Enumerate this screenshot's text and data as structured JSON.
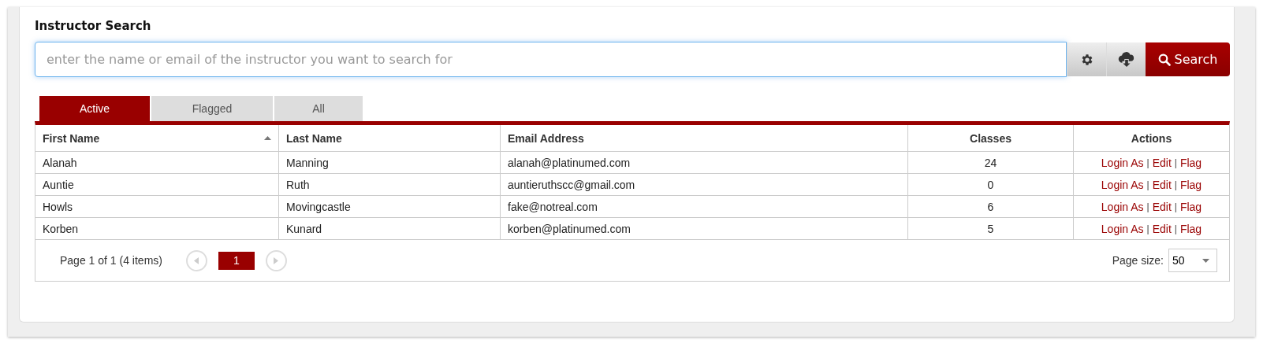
{
  "title": "Instructor Search",
  "search": {
    "placeholder": "enter the name or email of the instructor you want to search for",
    "button": "Search"
  },
  "tabs": [
    {
      "label": "Active",
      "selected": true
    },
    {
      "label": "Flagged",
      "selected": false
    },
    {
      "label": "All",
      "selected": false
    }
  ],
  "table": {
    "columns": [
      {
        "label": "First Name",
        "centered": false,
        "sorted_ascending": true
      },
      {
        "label": "Last Name",
        "centered": false,
        "sorted_ascending": false
      },
      {
        "label": "Email Address",
        "centered": false,
        "sorted_ascending": false
      },
      {
        "label": "Classes",
        "centered": true,
        "sorted_ascending": false
      },
      {
        "label": "Actions",
        "centered": true,
        "sorted_ascending": false
      }
    ],
    "action_separator": "|",
    "rows": [
      {
        "cells": [
          "Alanah",
          "Manning",
          "alanah@platinumed.com",
          "24"
        ],
        "actions": [
          "Login As",
          "Edit",
          "Flag"
        ]
      },
      {
        "cells": [
          "Auntie",
          "Ruth",
          "auntieruthscc@gmail.com",
          "0"
        ],
        "actions": [
          "Login As",
          "Edit",
          "Flag"
        ]
      },
      {
        "cells": [
          "Howls",
          "Movingcastle",
          "fake@notreal.com",
          "6"
        ],
        "actions": [
          "Login As",
          "Edit",
          "Flag"
        ]
      },
      {
        "cells": [
          "Korben",
          "Kunard",
          "korben@platinumed.com",
          "5"
        ],
        "actions": [
          "Login As",
          "Edit",
          "Flag"
        ]
      }
    ]
  },
  "pager": {
    "info": "Page 1 of 1 (4 items)",
    "pages": [
      {
        "label": "1",
        "selected": true
      }
    ],
    "page_size_label": "Page size:",
    "page_size": "50"
  }
}
